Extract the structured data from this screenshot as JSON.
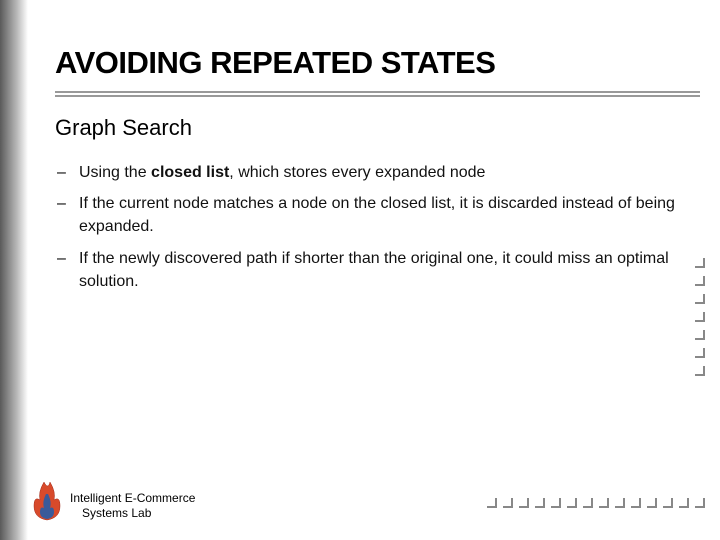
{
  "title": "AVOIDING REPEATED STATES",
  "subtitle": "Graph Search",
  "bullets": [
    {
      "pre": "Using the ",
      "bold": "closed list",
      "post": ", which stores every expanded node"
    },
    {
      "pre": "If the current node matches a node on the closed list, it is discarded instead of being expanded.",
      "bold": "",
      "post": ""
    },
    {
      "pre": "If the newly discovered path if shorter than the original one, it could miss an optimal solution.",
      "bold": "",
      "post": ""
    }
  ],
  "footer": {
    "line1": "Intelligent E-Commerce",
    "line2": "Systems Lab"
  }
}
